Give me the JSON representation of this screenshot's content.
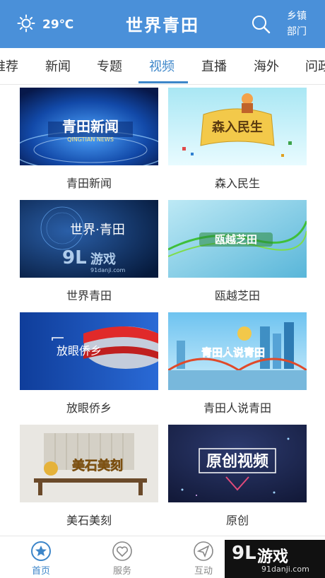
{
  "header": {
    "temperature": "29℃",
    "title": "世界青田",
    "dept_line1": "乡镇",
    "dept_line2": "部门",
    "icons": {
      "weather": "sun-icon",
      "search": "search-icon"
    }
  },
  "tabs": [
    {
      "label": "推荐"
    },
    {
      "label": "新闻"
    },
    {
      "label": "专题"
    },
    {
      "label": "视频",
      "active": true
    },
    {
      "label": "直播"
    },
    {
      "label": "海外"
    },
    {
      "label": "问政"
    }
  ],
  "cards": [
    {
      "label": "青田新闻",
      "thumb_title": "青田新闻",
      "thumb_sub": "QINGTIAN NEWS"
    },
    {
      "label": "森入民生",
      "thumb_title": "森入民生"
    },
    {
      "label": "世界青田",
      "thumb_title": "世界·青田",
      "watermark": "游戏",
      "watermark_url": "91danji.com"
    },
    {
      "label": "瓯越芝田",
      "thumb_title": "瓯越芝田"
    },
    {
      "label": "放眼侨乡",
      "thumb_title": "放眼侨乡"
    },
    {
      "label": "青田人说青田",
      "thumb_title": "青田人说青田"
    },
    {
      "label": "美石美刻",
      "thumb_title": "美石美刻"
    },
    {
      "label": "原创",
      "thumb_title": "原创视频"
    }
  ],
  "bottom_nav": [
    {
      "label": "首页",
      "icon": "star-icon",
      "active": true
    },
    {
      "label": "服务",
      "icon": "heart-icon"
    },
    {
      "label": "互动",
      "icon": "send-icon"
    }
  ],
  "watermark": {
    "logo": "9L",
    "text": "游戏",
    "url": "91danji.com"
  },
  "colors": {
    "primary": "#4a90d9",
    "accent": "#3d86c9"
  }
}
